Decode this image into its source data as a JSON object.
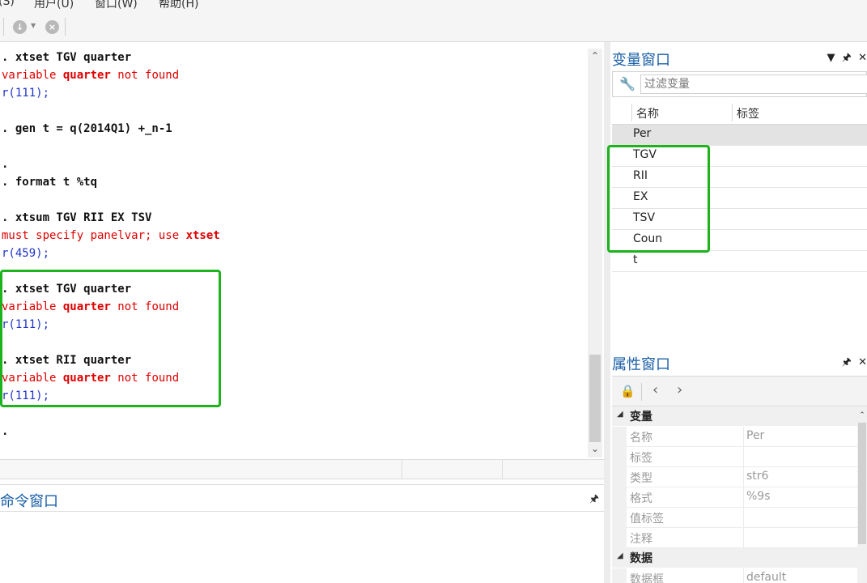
{
  "menu": [
    "(S)",
    "用户(U)",
    "窗口(W)",
    "帮助(H)"
  ],
  "toolbar": {
    "down_icon": "↓",
    "close_icon": "×"
  },
  "results": {
    "lines": [
      {
        "text": ". xtset TGV quarter",
        "kind": "cmd"
      },
      {
        "text_pre": "variable ",
        "text_bold": "quarter",
        "text_post": " not found",
        "kind": "err"
      },
      {
        "text": "r(111);",
        "kind": "rc"
      },
      {
        "text": ". gen t = q(2014Q1) +_n-1",
        "kind": "cmd"
      },
      {
        "text": ".",
        "kind": "cmd"
      },
      {
        "text": ". format t %tq",
        "kind": "cmd"
      },
      {
        "text": ". xtsum TGV RII EX TSV",
        "kind": "cmd"
      },
      {
        "text_pre": "must specify panelvar; use ",
        "text_bold": "xtset",
        "text_post": "",
        "kind": "err"
      },
      {
        "text": "r(459);",
        "kind": "rc"
      },
      {
        "text": ". xtset TGV quarter",
        "kind": "cmd"
      },
      {
        "text_pre": "variable ",
        "text_bold": "quarter",
        "text_post": " not found",
        "kind": "err"
      },
      {
        "text": "r(111);",
        "kind": "rc"
      },
      {
        "text": ". xtset RII quarter",
        "kind": "cmd"
      },
      {
        "text_pre": "variable ",
        "text_bold": "quarter",
        "text_post": " not found",
        "kind": "err"
      },
      {
        "text": "r(111);",
        "kind": "rc"
      },
      {
        "text": ".",
        "kind": "cmd"
      }
    ]
  },
  "command_window": {
    "title": "命令窗口"
  },
  "variables_window": {
    "title": "变量窗口",
    "filter_placeholder": "过滤变量",
    "columns": [
      "名称",
      "标签"
    ],
    "variables": [
      "Per",
      "TGV",
      "RII",
      "EX",
      "TSV",
      "Coun",
      "t"
    ]
  },
  "properties_window": {
    "title": "属性窗口",
    "sections": [
      {
        "label": "变量",
        "rows": [
          {
            "key": "名称",
            "value": "Per"
          },
          {
            "key": "标签",
            "value": ""
          },
          {
            "key": "类型",
            "value": "str6"
          },
          {
            "key": "格式",
            "value": "%9s"
          },
          {
            "key": "值标签",
            "value": ""
          },
          {
            "key": "注释",
            "value": ""
          }
        ]
      },
      {
        "label": "数据",
        "rows": [
          {
            "key": "数据框",
            "value": "default"
          }
        ]
      }
    ]
  },
  "colors": {
    "highlight": "#1db31d",
    "pane_title": "#1a5fa8",
    "error": "#e00000",
    "return_code": "#1f35c8"
  }
}
